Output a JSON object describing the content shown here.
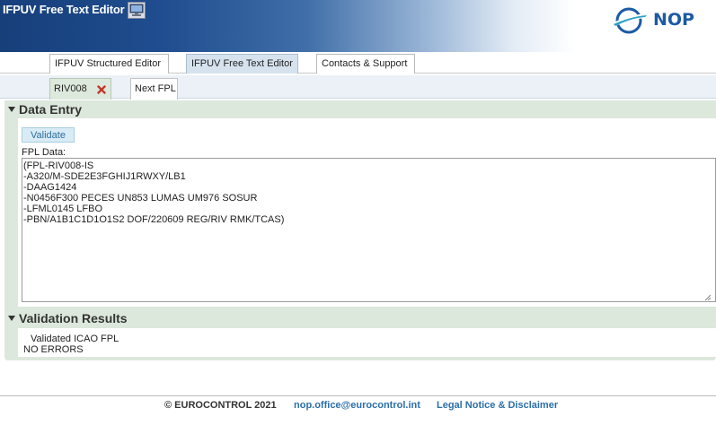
{
  "header": {
    "app_title": "IFPUV Free Text Editor",
    "logo_text": "NOP",
    "icons": [
      "monitor-icon",
      "nop-logo-icon"
    ]
  },
  "tabs": [
    {
      "label": "IFPUV Structured Editor",
      "active": false
    },
    {
      "label": "IFPUV Free Text Editor",
      "active": true
    },
    {
      "label": "Contacts & Support",
      "active": false
    }
  ],
  "subtabs": [
    {
      "label": "RIV008",
      "active": true,
      "closable": true
    },
    {
      "label": "Next FPL",
      "active": false,
      "closable": false
    }
  ],
  "data_entry": {
    "heading": "Data Entry",
    "validate_label": "Validate",
    "fpl_label": "FPL Data:",
    "fpl_text": "(FPL-RIV008-IS\n-A320/M-SDE2E3FGHIJ1RWXY/LB1\n-DAAG1424\n-N0456F300 PECES UN853 LUMAS UM976 SOSUR\n-LFML0145 LFBO\n-PBN/A1B1C1D1O1S2 DOF/220609 REG/RIV RMK/TCAS)"
  },
  "validation": {
    "heading": "Validation Results",
    "title": "Validated ICAO FPL",
    "value": "NO ERRORS"
  },
  "footer": {
    "copyright": "© EUROCONTROL 2021",
    "email": "nop.office@eurocontrol.int",
    "legal": "Legal Notice & Disclaimer"
  },
  "colors": {
    "header_dark": "#173f7a",
    "logo_blue": "#1b5aa6",
    "panel_green": "#dde8dc",
    "link_blue": "#2a6fa8",
    "close_red": "#c0392b"
  }
}
